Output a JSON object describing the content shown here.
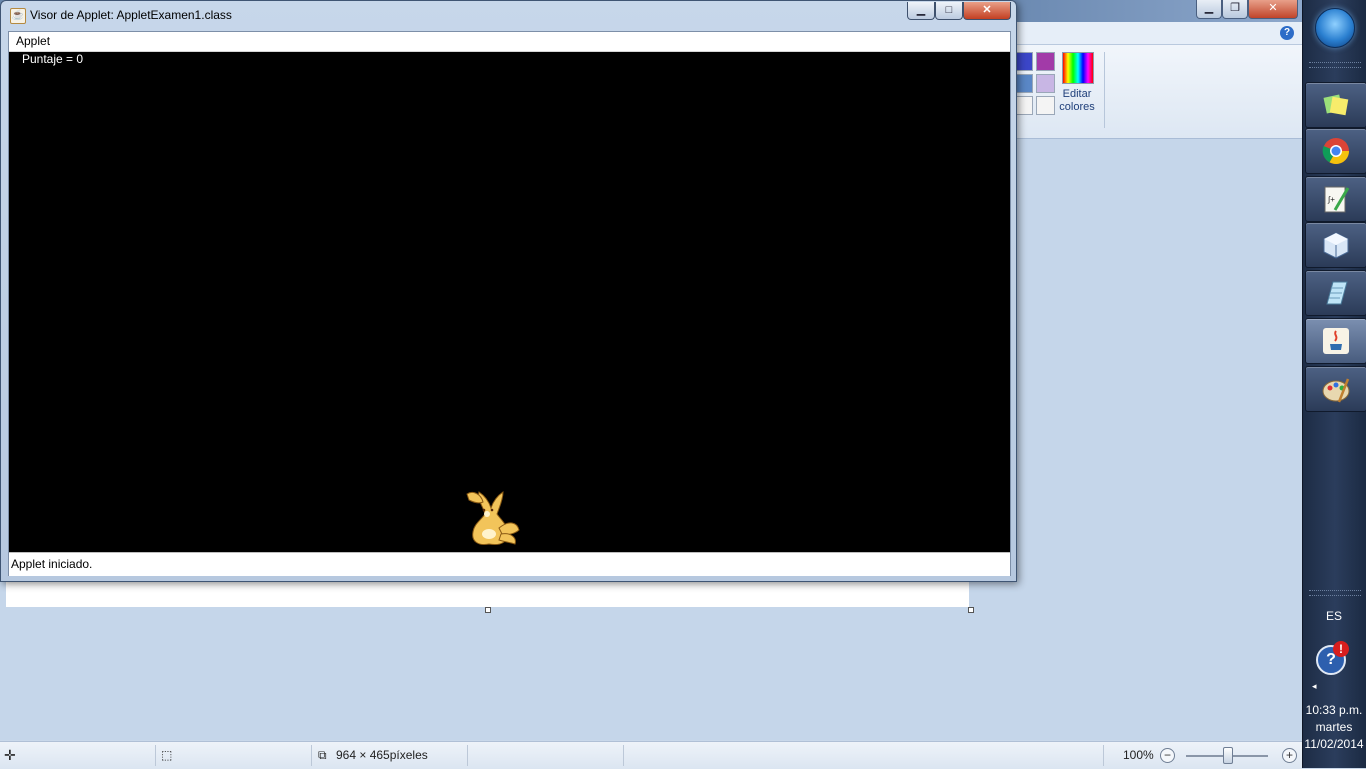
{
  "applet_window": {
    "title": "Visor de Applet: AppletExamen1.class",
    "menu": [
      "Applet"
    ],
    "score_label": "Puntaje = 0",
    "status": "Applet iniciado.",
    "buttons": {
      "minimize": "minimize-icon",
      "maximize": "maximize-icon",
      "close": "close-icon"
    }
  },
  "paint": {
    "edit_colors_label": "Editar colores",
    "help": "?",
    "statusbar": {
      "image_size": "964 × 465píxeles",
      "zoom": "100%",
      "zoom_out": "−",
      "zoom_in": "+"
    },
    "palette": [
      "#3b46c8",
      "#a23aa8",
      "#5a87c6",
      "#c8b6e4",
      "#f4f4f4",
      "#f4f4f4"
    ]
  },
  "taskbar": {
    "language": "ES",
    "alert": "!",
    "help": "?",
    "show_hidden": "◂",
    "time": "10:33 p.m.",
    "day": "martes",
    "date": "11/02/2014",
    "pinned": [
      "sticky-notes-icon",
      "chrome-icon",
      "equation-editor-icon",
      "virtualbox-icon",
      "notepad-icon",
      "java-icon",
      "paint-icon"
    ]
  }
}
